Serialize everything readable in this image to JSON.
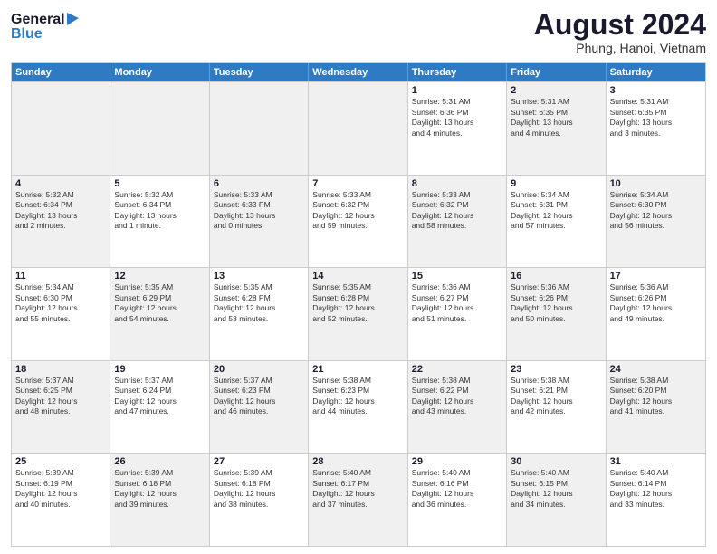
{
  "header": {
    "logo_line1": "General",
    "logo_line2": "Blue",
    "month_title": "August 2024",
    "subtitle": "Phung, Hanoi, Vietnam"
  },
  "weekdays": [
    "Sunday",
    "Monday",
    "Tuesday",
    "Wednesday",
    "Thursday",
    "Friday",
    "Saturday"
  ],
  "rows": [
    [
      {
        "day": "",
        "info": "",
        "shaded": true
      },
      {
        "day": "",
        "info": "",
        "shaded": true
      },
      {
        "day": "",
        "info": "",
        "shaded": true
      },
      {
        "day": "",
        "info": "",
        "shaded": true
      },
      {
        "day": "1",
        "info": "Sunrise: 5:31 AM\nSunset: 6:36 PM\nDaylight: 13 hours\nand 4 minutes.",
        "shaded": false
      },
      {
        "day": "2",
        "info": "Sunrise: 5:31 AM\nSunset: 6:35 PM\nDaylight: 13 hours\nand 4 minutes.",
        "shaded": true
      },
      {
        "day": "3",
        "info": "Sunrise: 5:31 AM\nSunset: 6:35 PM\nDaylight: 13 hours\nand 3 minutes.",
        "shaded": false
      }
    ],
    [
      {
        "day": "4",
        "info": "Sunrise: 5:32 AM\nSunset: 6:34 PM\nDaylight: 13 hours\nand 2 minutes.",
        "shaded": true
      },
      {
        "day": "5",
        "info": "Sunrise: 5:32 AM\nSunset: 6:34 PM\nDaylight: 13 hours\nand 1 minute.",
        "shaded": false
      },
      {
        "day": "6",
        "info": "Sunrise: 5:33 AM\nSunset: 6:33 PM\nDaylight: 13 hours\nand 0 minutes.",
        "shaded": true
      },
      {
        "day": "7",
        "info": "Sunrise: 5:33 AM\nSunset: 6:32 PM\nDaylight: 12 hours\nand 59 minutes.",
        "shaded": false
      },
      {
        "day": "8",
        "info": "Sunrise: 5:33 AM\nSunset: 6:32 PM\nDaylight: 12 hours\nand 58 minutes.",
        "shaded": true
      },
      {
        "day": "9",
        "info": "Sunrise: 5:34 AM\nSunset: 6:31 PM\nDaylight: 12 hours\nand 57 minutes.",
        "shaded": false
      },
      {
        "day": "10",
        "info": "Sunrise: 5:34 AM\nSunset: 6:30 PM\nDaylight: 12 hours\nand 56 minutes.",
        "shaded": true
      }
    ],
    [
      {
        "day": "11",
        "info": "Sunrise: 5:34 AM\nSunset: 6:30 PM\nDaylight: 12 hours\nand 55 minutes.",
        "shaded": false
      },
      {
        "day": "12",
        "info": "Sunrise: 5:35 AM\nSunset: 6:29 PM\nDaylight: 12 hours\nand 54 minutes.",
        "shaded": true
      },
      {
        "day": "13",
        "info": "Sunrise: 5:35 AM\nSunset: 6:28 PM\nDaylight: 12 hours\nand 53 minutes.",
        "shaded": false
      },
      {
        "day": "14",
        "info": "Sunrise: 5:35 AM\nSunset: 6:28 PM\nDaylight: 12 hours\nand 52 minutes.",
        "shaded": true
      },
      {
        "day": "15",
        "info": "Sunrise: 5:36 AM\nSunset: 6:27 PM\nDaylight: 12 hours\nand 51 minutes.",
        "shaded": false
      },
      {
        "day": "16",
        "info": "Sunrise: 5:36 AM\nSunset: 6:26 PM\nDaylight: 12 hours\nand 50 minutes.",
        "shaded": true
      },
      {
        "day": "17",
        "info": "Sunrise: 5:36 AM\nSunset: 6:26 PM\nDaylight: 12 hours\nand 49 minutes.",
        "shaded": false
      }
    ],
    [
      {
        "day": "18",
        "info": "Sunrise: 5:37 AM\nSunset: 6:25 PM\nDaylight: 12 hours\nand 48 minutes.",
        "shaded": true
      },
      {
        "day": "19",
        "info": "Sunrise: 5:37 AM\nSunset: 6:24 PM\nDaylight: 12 hours\nand 47 minutes.",
        "shaded": false
      },
      {
        "day": "20",
        "info": "Sunrise: 5:37 AM\nSunset: 6:23 PM\nDaylight: 12 hours\nand 46 minutes.",
        "shaded": true
      },
      {
        "day": "21",
        "info": "Sunrise: 5:38 AM\nSunset: 6:23 PM\nDaylight: 12 hours\nand 44 minutes.",
        "shaded": false
      },
      {
        "day": "22",
        "info": "Sunrise: 5:38 AM\nSunset: 6:22 PM\nDaylight: 12 hours\nand 43 minutes.",
        "shaded": true
      },
      {
        "day": "23",
        "info": "Sunrise: 5:38 AM\nSunset: 6:21 PM\nDaylight: 12 hours\nand 42 minutes.",
        "shaded": false
      },
      {
        "day": "24",
        "info": "Sunrise: 5:38 AM\nSunset: 6:20 PM\nDaylight: 12 hours\nand 41 minutes.",
        "shaded": true
      }
    ],
    [
      {
        "day": "25",
        "info": "Sunrise: 5:39 AM\nSunset: 6:19 PM\nDaylight: 12 hours\nand 40 minutes.",
        "shaded": false
      },
      {
        "day": "26",
        "info": "Sunrise: 5:39 AM\nSunset: 6:18 PM\nDaylight: 12 hours\nand 39 minutes.",
        "shaded": true
      },
      {
        "day": "27",
        "info": "Sunrise: 5:39 AM\nSunset: 6:18 PM\nDaylight: 12 hours\nand 38 minutes.",
        "shaded": false
      },
      {
        "day": "28",
        "info": "Sunrise: 5:40 AM\nSunset: 6:17 PM\nDaylight: 12 hours\nand 37 minutes.",
        "shaded": true
      },
      {
        "day": "29",
        "info": "Sunrise: 5:40 AM\nSunset: 6:16 PM\nDaylight: 12 hours\nand 36 minutes.",
        "shaded": false
      },
      {
        "day": "30",
        "info": "Sunrise: 5:40 AM\nSunset: 6:15 PM\nDaylight: 12 hours\nand 34 minutes.",
        "shaded": true
      },
      {
        "day": "31",
        "info": "Sunrise: 5:40 AM\nSunset: 6:14 PM\nDaylight: 12 hours\nand 33 minutes.",
        "shaded": false
      }
    ]
  ]
}
